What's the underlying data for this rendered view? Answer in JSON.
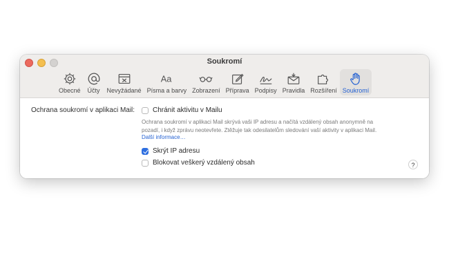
{
  "window": {
    "title": "Soukromí"
  },
  "toolbar": {
    "items": [
      {
        "label": "Obecné",
        "icon": "gear-icon"
      },
      {
        "label": "Účty",
        "icon": "at-icon"
      },
      {
        "label": "Nevyžádané",
        "icon": "junk-tray-icon"
      },
      {
        "label": "Písma a barvy",
        "icon": "fonts-icon"
      },
      {
        "label": "Zobrazení",
        "icon": "glasses-icon"
      },
      {
        "label": "Příprava",
        "icon": "compose-icon"
      },
      {
        "label": "Podpisy",
        "icon": "signature-icon"
      },
      {
        "label": "Pravidla",
        "icon": "rules-envelope-icon"
      },
      {
        "label": "Rozšíření",
        "icon": "puzzle-icon"
      },
      {
        "label": "Soukromí",
        "icon": "hand-icon"
      }
    ],
    "active": "Soukromí"
  },
  "privacy": {
    "section_label": "Ochrana soukromí v aplikaci Mail:",
    "protect_activity": {
      "label": "Chránit aktivitu v Mailu",
      "checked": false
    },
    "description_line1": "Ochrana soukromí v aplikaci Mail skrývá vaši IP adresu a načítá vzdálený obsah anonymně na",
    "description_line2": "pozadí, i když zprávu neotevřete. Ztěžuje tak odesilatelům sledování vaší aktivity v aplikaci Mail.",
    "more_info": "Další informace…",
    "hide_ip": {
      "label": "Skrýt IP adresu",
      "checked": true
    },
    "block_remote": {
      "label": "Blokovat veškerý vzdálený obsah",
      "checked": false
    },
    "help": "?"
  },
  "colors": {
    "accent": "#2f6fe0",
    "link": "#2461d2"
  }
}
